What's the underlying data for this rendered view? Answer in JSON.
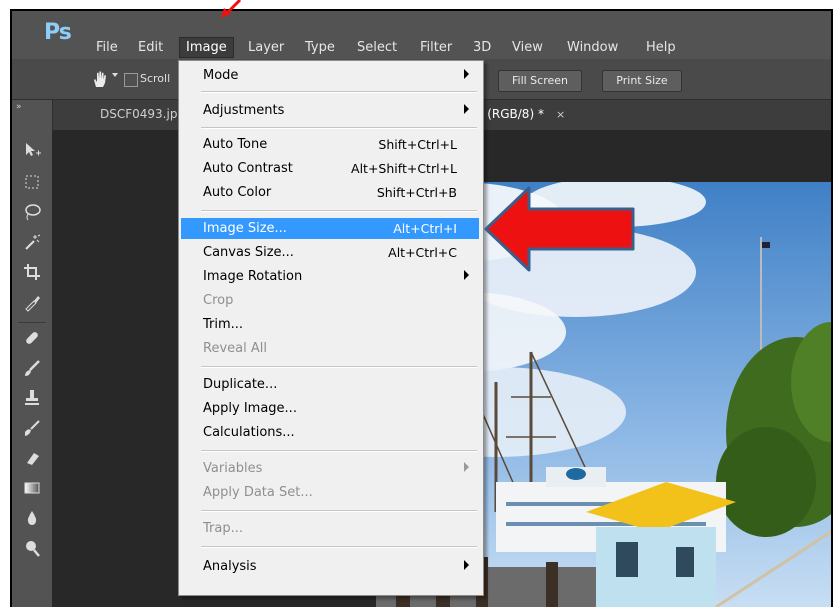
{
  "app": {
    "logo": "Ps",
    "menus": [
      "File",
      "Edit",
      "Image",
      "Layer",
      "Type",
      "Select",
      "Filter",
      "3D",
      "View",
      "Window",
      "Help"
    ],
    "active_menu": "Image"
  },
  "options_bar": {
    "scroll_label": "Scroll",
    "fill_screen_label": "Fill Screen",
    "print_size_label": "Print Size"
  },
  "tabs": [
    {
      "label": "DSCF0493.jp",
      "active": false
    },
    {
      "label": "% (RGB/8) *",
      "active": true
    }
  ],
  "tab_close_glyph": "×",
  "image_menu": {
    "items": [
      {
        "label": "Mode",
        "shortcut": "",
        "submenu": true,
        "disabled": false,
        "highlighted": false
      },
      {
        "label": "Adjustments",
        "shortcut": "",
        "submenu": true,
        "disabled": false,
        "highlighted": false
      },
      {
        "label": "Auto Tone",
        "shortcut": "Shift+Ctrl+L",
        "submenu": false,
        "disabled": false,
        "highlighted": false
      },
      {
        "label": "Auto Contrast",
        "shortcut": "Alt+Shift+Ctrl+L",
        "submenu": false,
        "disabled": false,
        "highlighted": false
      },
      {
        "label": "Auto Color",
        "shortcut": "Shift+Ctrl+B",
        "submenu": false,
        "disabled": false,
        "highlighted": false
      },
      {
        "label": "Image Size...",
        "shortcut": "Alt+Ctrl+I",
        "submenu": false,
        "disabled": false,
        "highlighted": true
      },
      {
        "label": "Canvas Size...",
        "shortcut": "Alt+Ctrl+C",
        "submenu": false,
        "disabled": false,
        "highlighted": false
      },
      {
        "label": "Image Rotation",
        "shortcut": "",
        "submenu": true,
        "disabled": false,
        "highlighted": false
      },
      {
        "label": "Crop",
        "shortcut": "",
        "submenu": false,
        "disabled": true,
        "highlighted": false
      },
      {
        "label": "Trim...",
        "shortcut": "",
        "submenu": false,
        "disabled": false,
        "highlighted": false
      },
      {
        "label": "Reveal All",
        "shortcut": "",
        "submenu": false,
        "disabled": true,
        "highlighted": false
      },
      {
        "label": "Duplicate...",
        "shortcut": "",
        "submenu": false,
        "disabled": false,
        "highlighted": false
      },
      {
        "label": "Apply Image...",
        "shortcut": "",
        "submenu": false,
        "disabled": false,
        "highlighted": false
      },
      {
        "label": "Calculations...",
        "shortcut": "",
        "submenu": false,
        "disabled": false,
        "highlighted": false
      },
      {
        "label": "Variables",
        "shortcut": "",
        "submenu": true,
        "disabled": true,
        "highlighted": false
      },
      {
        "label": "Apply Data Set...",
        "shortcut": "",
        "submenu": false,
        "disabled": true,
        "highlighted": false
      },
      {
        "label": "Trap...",
        "shortcut": "",
        "submenu": false,
        "disabled": true,
        "highlighted": false
      },
      {
        "label": "Analysis",
        "shortcut": "",
        "submenu": true,
        "disabled": false,
        "highlighted": false
      }
    ]
  },
  "colors": {
    "highlight": "#3399ff",
    "annotation_arrow": "#ee1111",
    "annotation_arrow_outline": "#3a5f8a",
    "chrome_dark": "#535353",
    "ps_logo": "#8ecdf7"
  },
  "annotation": {
    "icon": "red-arrow-pointing-left"
  }
}
